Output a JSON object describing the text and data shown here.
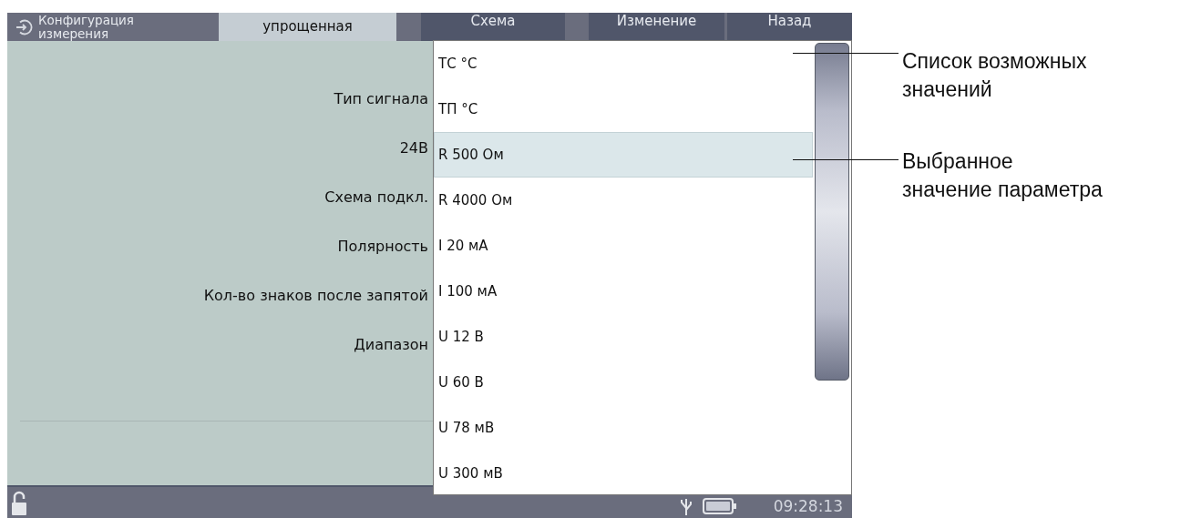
{
  "header": {
    "title": "Конфигурация измерения",
    "tabs": [
      {
        "label": "упрощенная",
        "selected": true
      },
      {
        "label": "Схема",
        "selected": false
      },
      {
        "label": "Изменение",
        "selected": false
      },
      {
        "label": "Назад",
        "selected": false
      }
    ]
  },
  "parameters": [
    "Тип сигнала",
    "24В",
    "Схема подкл.",
    "Полярность",
    "Кол-во знаков после запятой",
    "Диапазон"
  ],
  "dropdown": {
    "options": [
      {
        "label": "ТС °С",
        "selected": false
      },
      {
        "label": "ТП °С",
        "selected": false
      },
      {
        "label": "R 500 Ом",
        "selected": true
      },
      {
        "label": "R 4000 Ом",
        "selected": false
      },
      {
        "label": "I 20 мА",
        "selected": false
      },
      {
        "label": "I 100 мА",
        "selected": false
      },
      {
        "label": "U 12 В",
        "selected": false
      },
      {
        "label": "U 60 В",
        "selected": false
      },
      {
        "label": "U 78 мВ",
        "selected": false
      },
      {
        "label": "U 300 мВ",
        "selected": false
      }
    ]
  },
  "status_bar": {
    "time": "09:28:13"
  },
  "callouts": [
    "Список возможных\nзначений",
    "Выбранное\nзначение параметра"
  ]
}
